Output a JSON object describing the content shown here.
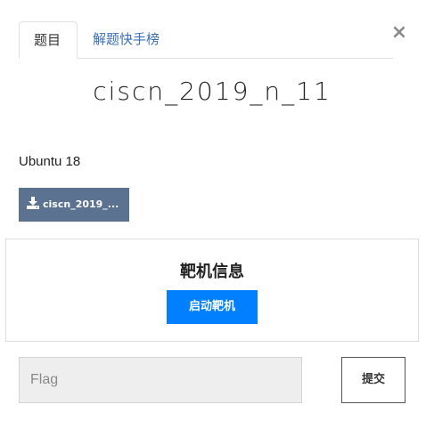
{
  "tabs": {
    "challenge_label": "题目",
    "leaderboard_label": "解题快手榜"
  },
  "close": {
    "label": "×"
  },
  "challenge": {
    "title": "ciscn_2019_n_11",
    "description": "Ubuntu 18",
    "download_label": "ciscn_2019_..."
  },
  "target": {
    "heading": "靶机信息",
    "start_label": "启动靶机"
  },
  "flag": {
    "placeholder": "Flag",
    "value": "",
    "submit_label": "提交"
  },
  "colors": {
    "tab_link": "#3a6fb5",
    "download_bg": "#5b7291",
    "start_bg": "#0080ff",
    "input_bg": "#eeeeee"
  },
  "icons": {
    "close": "close-icon",
    "download": "download-icon"
  }
}
